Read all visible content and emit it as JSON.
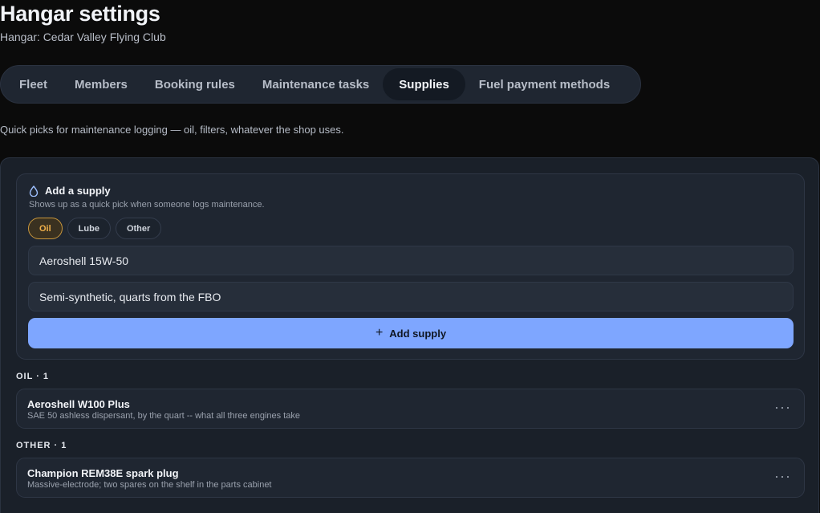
{
  "header": {
    "title": "Hangar settings",
    "subtitle": "Hangar: Cedar Valley Flying Club"
  },
  "tabs": [
    {
      "label": "Fleet",
      "active": false
    },
    {
      "label": "Members",
      "active": false
    },
    {
      "label": "Booking rules",
      "active": false
    },
    {
      "label": "Maintenance tasks",
      "active": false
    },
    {
      "label": "Supplies",
      "active": true
    },
    {
      "label": "Fuel payment methods",
      "active": false
    }
  ],
  "description": "Quick picks for maintenance logging — oil, filters, whatever the shop uses.",
  "add_supply": {
    "title": "Add a supply",
    "hint": "Shows up as a quick pick when someone logs maintenance.",
    "icon": "droplet-icon",
    "categories": [
      {
        "label": "Oil",
        "selected": true
      },
      {
        "label": "Lube",
        "selected": false
      },
      {
        "label": "Other",
        "selected": false
      }
    ],
    "name_value": "Aeroshell 15W-50",
    "notes_value": "Semi-synthetic, quarts from the FBO",
    "button_label": "Add supply",
    "button_icon": "plus-icon",
    "accent_color": "#7ea6ff",
    "selected_chip_color": "#f0b04a"
  },
  "groups": [
    {
      "label": "OIL · 1",
      "items": [
        {
          "name": "Aeroshell W100 Plus",
          "desc": "SAE 50 ashless dispersant, by the quart -- what all three engines take"
        }
      ]
    },
    {
      "label": "OTHER · 1",
      "items": [
        {
          "name": "Champion REM38E spark plug",
          "desc": "Massive-electrode; two spares on the shelf in the parts cabinet"
        }
      ]
    }
  ],
  "more_icon": "more-horizontal-icon"
}
